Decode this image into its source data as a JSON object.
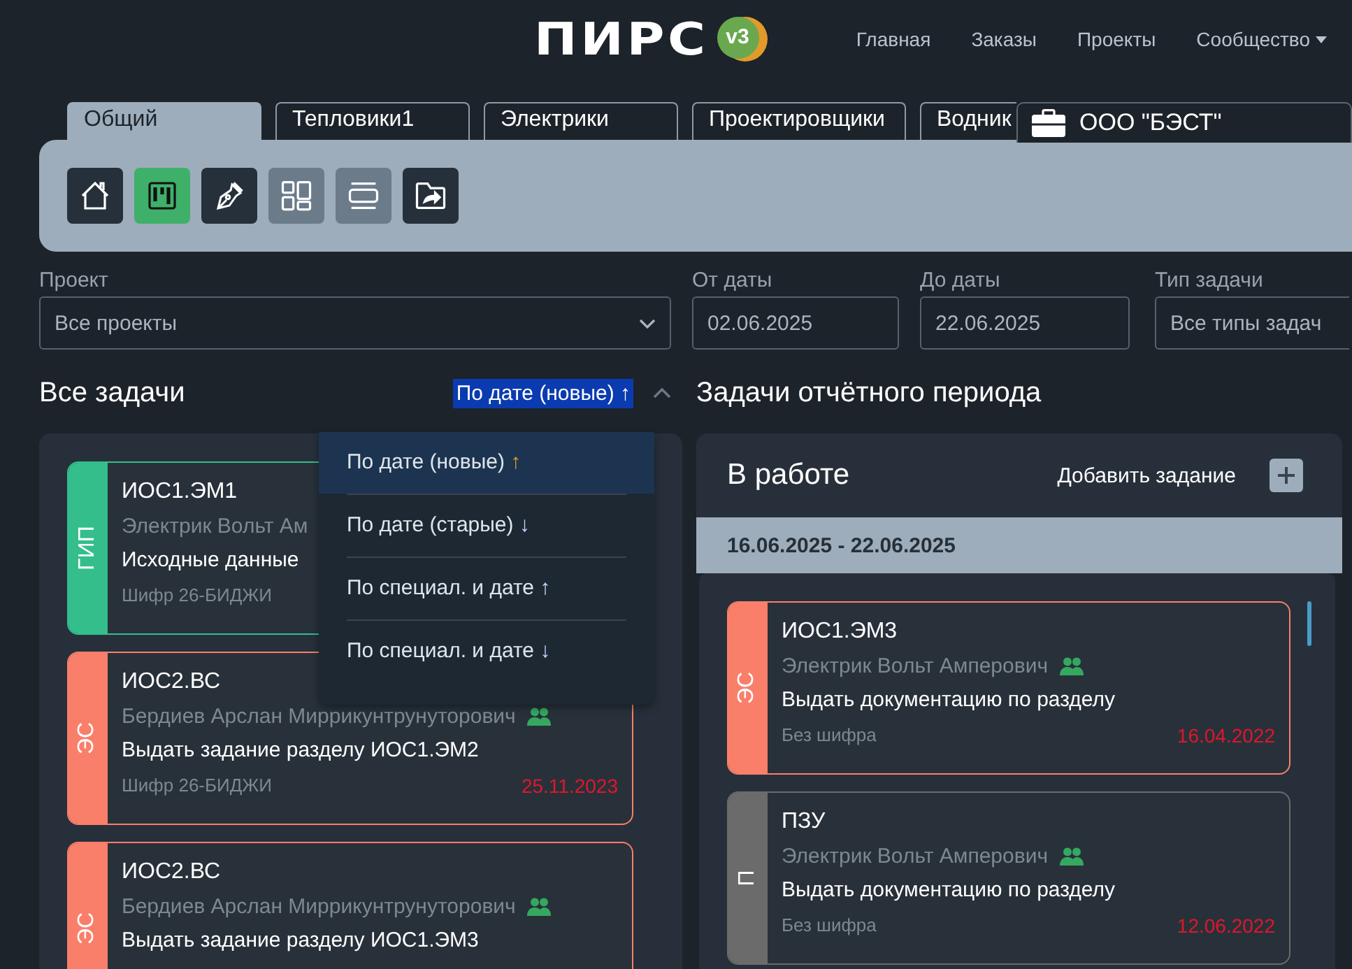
{
  "nav": {
    "logo": "ПИРС",
    "version": "v3",
    "links": [
      {
        "label": "Главная",
        "dropdown": false
      },
      {
        "label": "Заказы",
        "dropdown": false
      },
      {
        "label": "Проекты",
        "dropdown": false
      },
      {
        "label": "Сообщество",
        "dropdown": true
      }
    ]
  },
  "tabs": [
    {
      "label": "Общий",
      "selected": true
    },
    {
      "label": "Тепловики1",
      "selected": false
    },
    {
      "label": "Электрики",
      "selected": false
    },
    {
      "label": "Проектировщики",
      "selected": false
    },
    {
      "label": "Водник",
      "selected": false
    }
  ],
  "company": {
    "name": "ООО \"БЭСТ\""
  },
  "toolbar": [
    {
      "kind": "home",
      "selected": false,
      "dimmed": false
    },
    {
      "kind": "board",
      "selected": true,
      "dimmed": false
    },
    {
      "kind": "pen",
      "selected": false,
      "dimmed": false
    },
    {
      "kind": "tiles",
      "selected": false,
      "dimmed": true
    },
    {
      "kind": "rows",
      "selected": false,
      "dimmed": true
    },
    {
      "kind": "folder",
      "selected": false,
      "dimmed": false
    }
  ],
  "filters": [
    {
      "kind": "select",
      "label": "Проект",
      "value": "Все проекты"
    },
    {
      "kind": "text",
      "label": "От даты",
      "value": "02.06.2025"
    },
    {
      "kind": "text",
      "label": "До даты",
      "value": "22.06.2025"
    },
    {
      "kind": "text",
      "label": "Тип задачи",
      "value": "Все типы задач"
    }
  ],
  "all_tasks": {
    "title": "Все задачи",
    "sort": {
      "label": "По дате (новые) ↑",
      "expanded": true
    },
    "sort_options": [
      {
        "label": "По дате (новые)",
        "arrow": "↑",
        "selected": true
      },
      {
        "label": "По дате (старые)",
        "arrow": "↓",
        "selected": false
      },
      {
        "label": "По специал. и дате",
        "arrow": "↑",
        "selected": false
      },
      {
        "label": "По специал. и дате",
        "arrow": "↓",
        "selected": false
      }
    ],
    "cards": [
      {
        "tag": "ГИП",
        "color": "#33be8c",
        "code": "ИОС1.ЭМ1",
        "person": "Электрик Вольт Ам",
        "group": false,
        "task": "Исходные данные",
        "cipher": "Шифр 26-БИДЖИ"
      },
      {
        "tag": "ЭС",
        "color": "#fa7f6a",
        "code": "ИОС2.ВС",
        "person": "Бердиев Арслан Миррикунтрунуторович",
        "group": true,
        "task": "Выдать задание разделу ИОС1.ЭМ2",
        "cipher": "Шифр 26-БИДЖИ",
        "date": "25.11.2023"
      },
      {
        "tag": "ЭС",
        "color": "#fa7f6a",
        "code": "ИОС2.ВС",
        "person": "Бердиев Арслан Миррикунтрунуторович",
        "group": true,
        "task": "Выдать задание разделу ИОС1.ЭМ3"
      }
    ]
  },
  "period": {
    "title": "Задачи отчётного периода",
    "column": {
      "title": "В работе",
      "add_label": "Добавить задание"
    },
    "range": "16.06.2025 - 22.06.2025",
    "cards": [
      {
        "tag": "ЭС",
        "color": "#fa7f6a",
        "code": "ИОС1.ЭМ3",
        "person": "Электрик Вольт Амперович",
        "group": true,
        "task": "Выдать документацию по разделу",
        "cipher": "Без шифра",
        "date": "16.04.2022"
      },
      {
        "tag": "П",
        "color": "#6b6b6b",
        "code": "ПЗУ",
        "person": "Электрик Вольт Амперович",
        "group": true,
        "task": "Выдать документацию по разделу",
        "cipher": "Без шифра",
        "date": "12.06.2022"
      }
    ]
  }
}
